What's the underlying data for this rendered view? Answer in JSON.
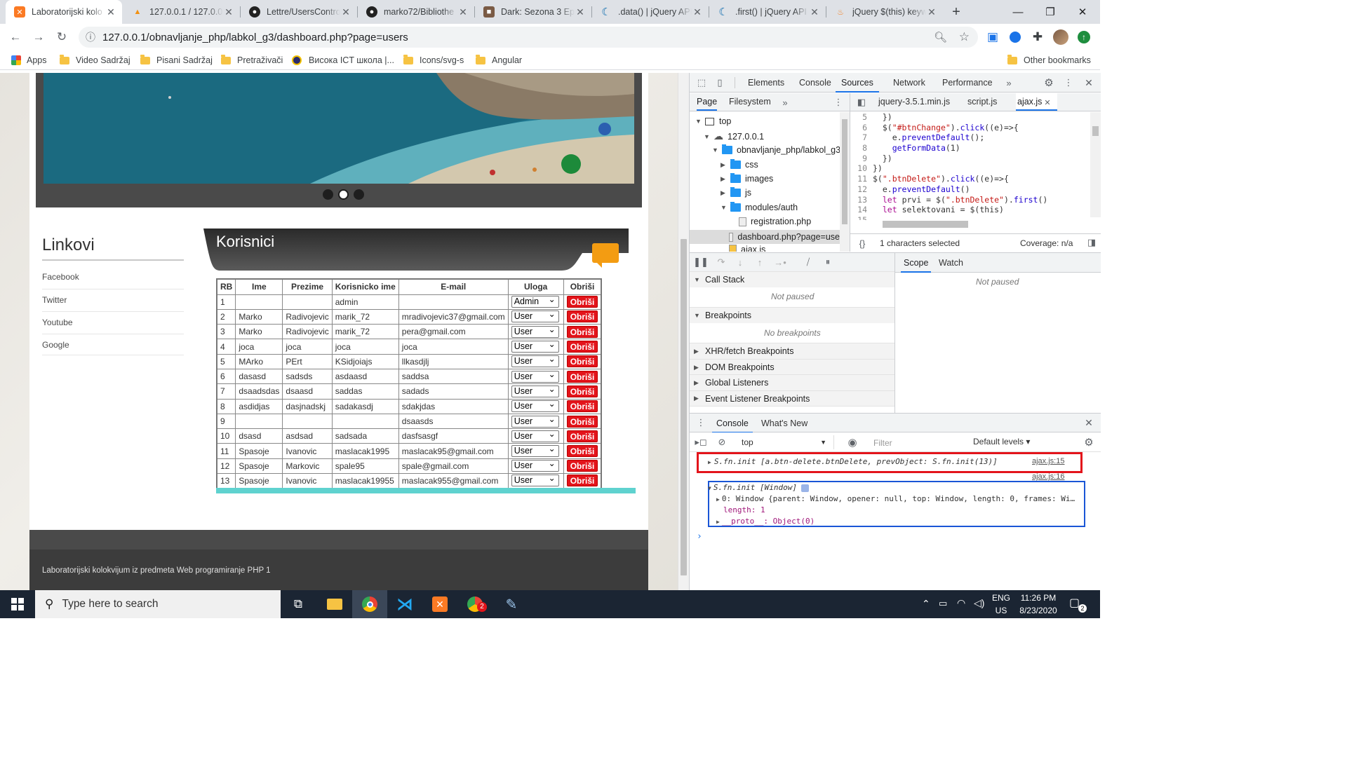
{
  "browser": {
    "tabs": [
      {
        "title": "Laboratorijski kolo",
        "active": true,
        "icon": "xampp-icon"
      },
      {
        "title": "127.0.0.1 / 127.0.0.",
        "icon": "phpmyadmin-icon"
      },
      {
        "title": "Lettre/UsersContro",
        "icon": "github-icon"
      },
      {
        "title": "marko72/Bibliothe",
        "icon": "github-icon"
      },
      {
        "title": "Dark: Sezona 3 Epi",
        "icon": "film-icon"
      },
      {
        "title": ".data() | jQuery API",
        "icon": "jquery-icon"
      },
      {
        "title": ".first() | jQuery API",
        "icon": "jquery-icon"
      },
      {
        "title": "jQuery $(this) keyw",
        "icon": "fire-icon"
      }
    ],
    "new_tab_label": "+",
    "url": "127.0.0.1/obnavljanje_php/labkol_g3/dashboard.php?page=users",
    "bookmarks": [
      "Apps",
      "Video Sadržaj",
      "Pisani Sadržaj",
      "Pretraživači",
      "Висока ICT школа |...",
      "Icons/svg-s",
      "Angular"
    ],
    "other_bookmarks": "Other bookmarks"
  },
  "page": {
    "sidebar": {
      "title": "Linkovi",
      "links": [
        "Facebook",
        "Twitter",
        "Youtube",
        "Google"
      ]
    },
    "section_title": "Korisnici",
    "table": {
      "headers": [
        "RB",
        "Ime",
        "Prezime",
        "Korisnicko ime",
        "E-mail",
        "Uloga",
        "Obriši"
      ],
      "delete_label": "Obriši",
      "rows": [
        {
          "rb": "1",
          "ime": "",
          "prezime": "",
          "korisnicko": "admin",
          "email": "",
          "uloga": "Admin"
        },
        {
          "rb": "2",
          "ime": "Marko",
          "prezime": "Radivojevic",
          "korisnicko": "marik_72",
          "email": "mradivojevic37@gmail.com",
          "uloga": "User"
        },
        {
          "rb": "3",
          "ime": "Marko",
          "prezime": "Radivojevic",
          "korisnicko": "marik_72",
          "email": "pera@gmail.com",
          "uloga": "User"
        },
        {
          "rb": "4",
          "ime": "joca",
          "prezime": "joca",
          "korisnicko": "joca",
          "email": "joca",
          "uloga": "User"
        },
        {
          "rb": "5",
          "ime": "MArko",
          "prezime": "PErt",
          "korisnicko": "KSidjoiajs",
          "email": "llkasdjlj",
          "uloga": "User"
        },
        {
          "rb": "6",
          "ime": "dasasd",
          "prezime": "sadsds",
          "korisnicko": "asdaasd",
          "email": "saddsa",
          "uloga": "User"
        },
        {
          "rb": "7",
          "ime": "dsaadsdas",
          "prezime": "dsaasd",
          "korisnicko": "saddas",
          "email": "sadads",
          "uloga": "User"
        },
        {
          "rb": "8",
          "ime": "asdidjas",
          "prezime": "dasjnadskj",
          "korisnicko": "sadakasdj",
          "email": "sdakjdas",
          "uloga": "User"
        },
        {
          "rb": "9",
          "ime": "",
          "prezime": "",
          "korisnicko": "",
          "email": "dsaasds",
          "uloga": "User"
        },
        {
          "rb": "10",
          "ime": "dsasd",
          "prezime": "asdsad",
          "korisnicko": "sadsada",
          "email": "dasfsasgf",
          "uloga": "User"
        },
        {
          "rb": "11",
          "ime": "Spasoje",
          "prezime": "Ivanovic",
          "korisnicko": "maslacak1995",
          "email": "maslacak95@gmail.com",
          "uloga": "User"
        },
        {
          "rb": "12",
          "ime": "Spasoje",
          "prezime": "Markovic",
          "korisnicko": "spale95",
          "email": "spale@gmail.com",
          "uloga": "User"
        },
        {
          "rb": "13",
          "ime": "Spasoje",
          "prezime": "Ivanovic",
          "korisnicko": "maslacak19955",
          "email": "maslacak955@gmail.com",
          "uloga": "User"
        }
      ]
    },
    "footer": "Laboratorijski kolokvijum iz predmeta Web programiranje PHP 1"
  },
  "devtools": {
    "main_tabs": [
      "Elements",
      "Console",
      "Sources",
      "Network",
      "Performance"
    ],
    "active_main_tab": "Sources",
    "nav_tabs": [
      "Page",
      "Filesystem"
    ],
    "file_tabs": [
      "jquery-3.5.1.min.js",
      "script.js",
      "ajax.js"
    ],
    "tree": {
      "top": "top",
      "host": "127.0.0.1",
      "project": "obnavljanje_php/labkol_g3",
      "folders": [
        "css",
        "images",
        "js",
        "modules/auth"
      ],
      "files": [
        "registration.php",
        "dashboard.php?page=use",
        "ajax.js"
      ]
    },
    "code_lines": [
      {
        "n": "5",
        "t": "  })"
      },
      {
        "n": "6",
        "t": "  $(\"#btnChange\").click((e)=>{"
      },
      {
        "n": "7",
        "t": "    e.preventDefault();"
      },
      {
        "n": "8",
        "t": "    getFormData(1)"
      },
      {
        "n": "9",
        "t": "  })"
      },
      {
        "n": "10",
        "t": "})"
      },
      {
        "n": "11",
        "t": "$(\".btnDelete\").click((e)=>{"
      },
      {
        "n": "12",
        "t": "  e.preventDefault()"
      },
      {
        "n": "13",
        "t": "  let prvi = $(\".btnDelete\").first()"
      },
      {
        "n": "14",
        "t": "  let selektovani = $(this)"
      },
      {
        "n": "15",
        "t": "      ..."
      },
      {
        "n": "16",
        "t": ""
      }
    ],
    "status_selected": "1 characters selected",
    "coverage": "Coverage: n/a",
    "debugger_sections": {
      "call_stack": "Call Stack",
      "not_paused": "Not paused",
      "breakpoints": "Breakpoints",
      "no_breakpoints": "No breakpoints",
      "others": [
        "XHR/fetch Breakpoints",
        "DOM Breakpoints",
        "Global Listeners",
        "Event Listener Breakpoints"
      ]
    },
    "scope_tabs": [
      "Scope",
      "Watch"
    ],
    "scope_not_paused": "Not paused",
    "drawer_tabs": [
      "Console",
      "What's New"
    ],
    "console_context": "top",
    "filter_placeholder": "Filter",
    "levels": "Default levels ▾",
    "console_lines": {
      "line1": "S.fn.init [a.btn-delete.btnDelete, prevObject: S.fn.init(13)]",
      "link1": "ajax.js:15",
      "link2": "ajax.js:16",
      "line2": "S.fn.init [Window]",
      "line3": "0: Window {parent: Window, opener: null, top: Window, length: 0, frames: Wi…",
      "line4": "length: 1",
      "line5": "__proto__: Object(0)"
    },
    "highlight_red": "#e3141b",
    "highlight_blue": "#1a56d6"
  },
  "taskbar": {
    "search_placeholder": "Type here to search",
    "lang": "ENG",
    "region": "US",
    "time": "11:26 PM",
    "date": "8/23/2020",
    "notification_count": "2"
  }
}
